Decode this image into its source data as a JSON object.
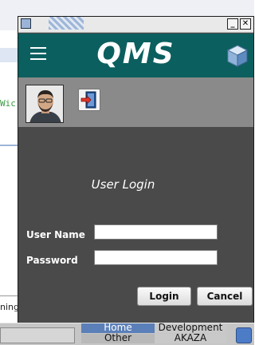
{
  "background": {
    "code_fragment": "Wic",
    "text_fragment": "ning"
  },
  "taskbar": {
    "workspaces": [
      "Home",
      "Development",
      "Other",
      "AKAZA"
    ]
  },
  "window": {
    "controls": {
      "minimize": "_",
      "close": "✕"
    },
    "header": {
      "app_title": "QMS",
      "menu_icon": "hamburger-menu-icon",
      "logo_icon": "cube-icon"
    },
    "profile": {
      "avatar": "user-avatar",
      "logout_icon": "logout-icon"
    },
    "login": {
      "title": "User Login",
      "username_label": "User Name",
      "username_value": "",
      "password_label": "Password",
      "password_value": "",
      "login_button": "Login",
      "cancel_button": "Cancel"
    }
  },
  "colors": {
    "header": "#0c5f5f",
    "profile_bar": "#8a8a8a",
    "content": "#4a4a4a"
  }
}
